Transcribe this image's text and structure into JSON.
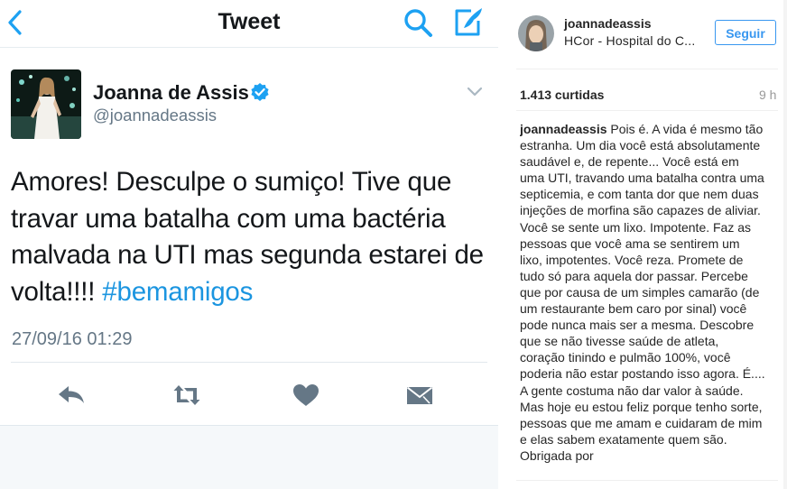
{
  "twitter": {
    "header": {
      "title": "Tweet",
      "back_icon": "chevron-left-icon",
      "search_icon": "search-icon",
      "compose_icon": "compose-icon"
    },
    "tweet": {
      "display_name": "Joanna de Assis",
      "username": "@joannadeassis",
      "verified": true,
      "text": "Amores! Desculpe o sumiço! Tive que travar uma batalha com uma bactéria malvada na UTI mas segunda estarei de volta!!!! ",
      "hashtag": "#bemamigos",
      "timestamp": "27/09/16 01:29"
    },
    "actions": [
      "reply-icon",
      "retweet-icon",
      "like-icon",
      "direct-message-icon"
    ],
    "colors": {
      "accent": "#1da1f2",
      "hashtag": "#1b95e0",
      "text": "#14171a",
      "muted": "#657786"
    }
  },
  "instagram": {
    "username": "joannadeassis",
    "location": "HCor - Hospital do Coração",
    "follow_label": "Seguir",
    "likes": "1.413 curtidas",
    "time_ago": "9 h",
    "caption_user": "joannadeassis",
    "caption_text": " Pois é. A vida é mesmo tão estranha. Um dia você está absolutamente saudável e, de repente... Você está em uma UTI, travando uma batalha contra uma septicemia, e com tanta dor que nem duas injeções de morfina são capazes de aliviar. Você se sente um lixo. Impotente. Faz as pessoas que você ama se sentirem um lixo, impotentes. Você reza. Promete de tudo só para aquela dor passar. Percebe que por causa de um simples camarão (de um restaurante bem caro por sinal) você pode nunca mais ser a mesma. Descobre que se não tivesse saúde de atleta, coração tinindo e pulmão 100%, você poderia não estar postando isso agora. É.... A gente costuma não dar valor à saúde. Mas hoje eu estou feliz porque tenho sorte, pessoas que me amam e cuidaram de mim e elas sabem exatamente quem são. Obrigada por",
    "colors": {
      "follow": "#3897f0",
      "text": "#262626",
      "muted": "#999999"
    }
  }
}
